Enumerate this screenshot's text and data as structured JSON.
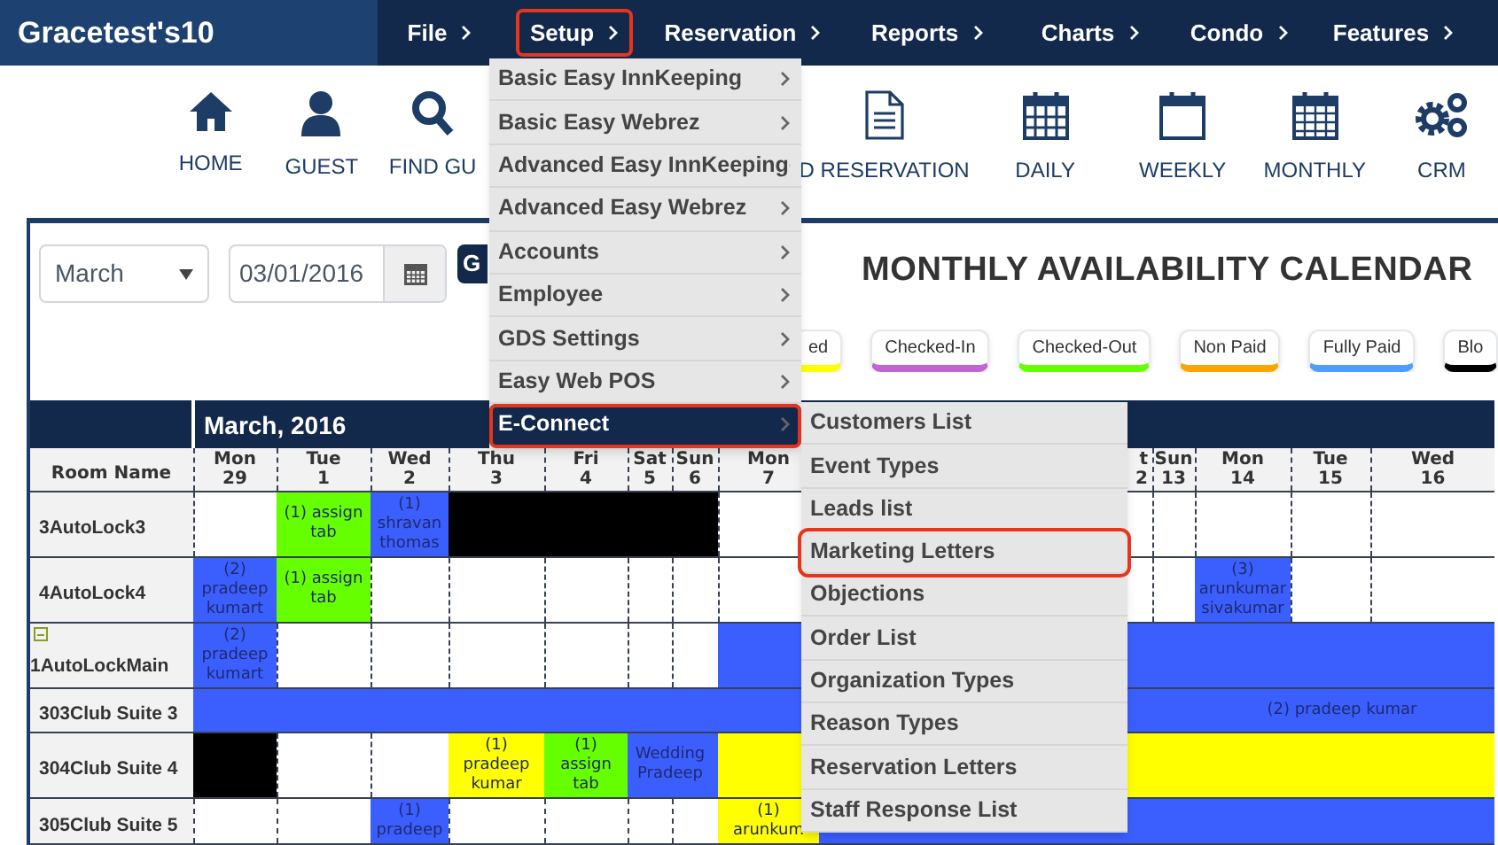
{
  "app": {
    "title": "Gracetest's10"
  },
  "nav": [
    {
      "label": "File",
      "annotated": false
    },
    {
      "label": "Setup",
      "annotated": true
    },
    {
      "label": "Reservation",
      "annotated": false
    },
    {
      "label": "Reports",
      "annotated": false
    },
    {
      "label": "Charts",
      "annotated": false
    },
    {
      "label": "Condo",
      "annotated": false
    },
    {
      "label": "Features",
      "annotated": false
    }
  ],
  "toolbar": [
    {
      "kind": "home",
      "label": "HOME"
    },
    {
      "kind": "guest",
      "label": "GUEST"
    },
    {
      "kind": "find",
      "label": "FIND GU"
    },
    {
      "kind": "gap"
    },
    {
      "kind": "document",
      "label": "D RESERVATION"
    },
    {
      "kind": "daily",
      "label": "DAILY"
    },
    {
      "kind": "weekly",
      "label": "WEEKLY"
    },
    {
      "kind": "monthly",
      "label": "MONTHLY"
    },
    {
      "kind": "crm",
      "label": "CRM"
    }
  ],
  "filters": {
    "month": "March",
    "date": "03/01/2016",
    "go_button": "G"
  },
  "calendar_title": "MONTHLY AVAILABILITY CALENDAR",
  "legend": [
    {
      "label": "ed",
      "color": "#ffff00"
    },
    {
      "label": "Checked-In",
      "color": "#c264d6"
    },
    {
      "label": "Checked-Out",
      "color": "#66ff00"
    },
    {
      "label": "Non Paid",
      "color": "#ffa500"
    },
    {
      "label": "Fully Paid",
      "color": "#4d9fff"
    },
    {
      "label": "Blo",
      "color": "#000000"
    }
  ],
  "calendar": {
    "month_label": "March, 2016",
    "room_header": "Room Name",
    "columns": [
      {
        "day": "Mon",
        "date": "29"
      },
      {
        "day": "Tue",
        "date": "1"
      },
      {
        "day": "Wed",
        "date": "2"
      },
      {
        "day": "Thu",
        "date": "3"
      },
      {
        "day": "Fri",
        "date": "4"
      },
      {
        "day": "Sat",
        "date": "5"
      },
      {
        "day": "Sun",
        "date": "6"
      },
      {
        "day": "Mon",
        "date": "7"
      },
      {
        "day": "t",
        "date": "2"
      },
      {
        "day": "Sun",
        "date": "13"
      },
      {
        "day": "Mon",
        "date": "14"
      },
      {
        "day": "Tue",
        "date": "15"
      },
      {
        "day": "Wed",
        "date": "16"
      }
    ],
    "rows": [
      {
        "room": "3AutoLock3",
        "cells": [
          {},
          {
            "color": "#66ff00",
            "text": "(1) assign tab"
          },
          {
            "color": "#3b5fff",
            "text": "(1) shravan thomas"
          },
          {
            "color": "#000000"
          },
          {
            "color": "#000000"
          },
          {
            "color": "#000000"
          },
          {
            "color": "#000000"
          },
          {},
          {},
          {},
          {},
          {},
          {}
        ]
      },
      {
        "room": "4AutoLock4",
        "cells": [
          {
            "color": "#3b5fff",
            "text": "(2) pradeep kumart"
          },
          {
            "color": "#66ff00",
            "text": "(1) assign tab"
          },
          {},
          {},
          {},
          {},
          {},
          {},
          {},
          {},
          {
            "color": "#3b5fff",
            "text": "(3) arunkumar sivakumar"
          },
          {},
          {}
        ]
      },
      {
        "room": "1AutoLockMain",
        "expanded": true,
        "cells": [
          {
            "color": "#3b5fff",
            "text": "(2) pradeep kumart"
          },
          {},
          {},
          {},
          {},
          {},
          {},
          {
            "color": "#3b5fff"
          },
          {
            "color": "#3b5fff"
          },
          {
            "color": "#3b5fff"
          },
          {
            "color": "#3b5fff"
          },
          {
            "color": "#3b5fff"
          },
          {
            "color": "#3b5fff"
          }
        ]
      },
      {
        "room": "303Club Suite 3",
        "cells": [
          {
            "color": "#3b5fff"
          },
          {
            "color": "#3b5fff"
          },
          {
            "color": "#3b5fff"
          },
          {
            "color": "#3b5fff"
          },
          {
            "color": "#3b5fff"
          },
          {
            "color": "#3b5fff"
          },
          {
            "color": "#3b5fff"
          },
          {
            "color": "#3b5fff"
          },
          {
            "color": "#3b5fff"
          },
          {
            "color": "#3b5fff"
          },
          {
            "color": "#3b5fff",
            "text": "(2) pradeep kumar"
          },
          {
            "color": "#3b5fff"
          },
          {
            "color": "#3b5fff"
          }
        ]
      },
      {
        "room": "304Club Suite 4",
        "cells": [
          {
            "color": "#000000"
          },
          {},
          {},
          {
            "color": "#ffff00",
            "text": "(1) pradeep kumar"
          },
          {
            "color": "#66ff00",
            "text": "(1) assign tab"
          },
          {
            "color": "#3b5fff",
            "text": "Wedding Pradeep"
          },
          {
            "color": "#3b5fff"
          },
          {
            "color": "#ffff00"
          },
          {
            "color": "#ffff00"
          },
          {
            "color": "#ffff00"
          },
          {
            "color": "#ffff00"
          },
          {
            "color": "#ffff00"
          },
          {
            "color": "#ffff00"
          }
        ]
      },
      {
        "room": "305Club Suite 5",
        "cells": [
          {},
          {},
          {
            "color": "#3b5fff",
            "text": "(1) pradeep"
          },
          {},
          {},
          {},
          {},
          {
            "color": "#ffff00",
            "text": "(1) arunkum"
          },
          {
            "color": "#3b5fff"
          },
          {
            "color": "#3b5fff"
          },
          {
            "color": "#3b5fff"
          },
          {
            "color": "#3b5fff"
          },
          {
            "color": "#3b5fff"
          }
        ]
      }
    ]
  },
  "setup_menu": [
    {
      "label": "Basic Easy InnKeeping",
      "selected": false,
      "annotated": false
    },
    {
      "label": "Basic Easy Webrez",
      "selected": false,
      "annotated": false
    },
    {
      "label": "Advanced Easy InnKeeping",
      "selected": false,
      "annotated": false
    },
    {
      "label": "Advanced Easy Webrez",
      "selected": false,
      "annotated": false
    },
    {
      "label": "Accounts",
      "selected": false,
      "annotated": false
    },
    {
      "label": "Employee",
      "selected": false,
      "annotated": false
    },
    {
      "label": "GDS Settings",
      "selected": false,
      "annotated": false
    },
    {
      "label": "Easy Web POS",
      "selected": false,
      "annotated": false
    },
    {
      "label": "E-Connect",
      "selected": true,
      "annotated": true
    }
  ],
  "econnect_menu": [
    {
      "label": "Customers List",
      "annotated": false
    },
    {
      "label": "Event Types",
      "annotated": false
    },
    {
      "label": "Leads list",
      "annotated": false
    },
    {
      "label": "Marketing Letters",
      "annotated": true
    },
    {
      "label": "Objections",
      "annotated": false
    },
    {
      "label": "Order List",
      "annotated": false
    },
    {
      "label": "Organization Types",
      "annotated": false
    },
    {
      "label": "Reason Types",
      "annotated": false
    },
    {
      "label": "Reservation Letters",
      "annotated": false
    },
    {
      "label": "Staff Response List",
      "annotated": false
    }
  ]
}
